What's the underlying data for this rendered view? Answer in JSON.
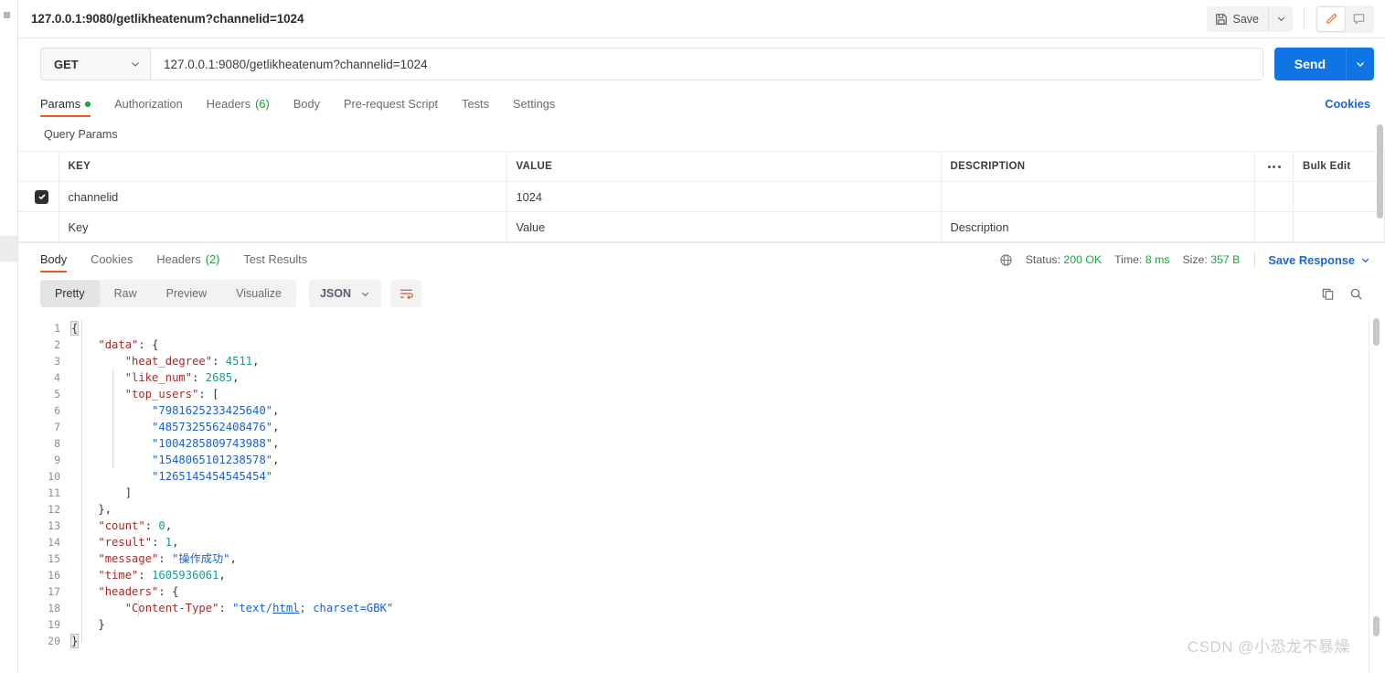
{
  "titlebar": {
    "tab_title": "127.0.0.1:9080/getlikheatenum?channelid=1024",
    "save_label": "Save",
    "save_icon": "floppy-disk-icon",
    "caret_icon": "chevron-down-icon",
    "edit_icon": "pencil-icon",
    "comment_icon": "comment-icon"
  },
  "request": {
    "method": "GET",
    "url": "127.0.0.1:9080/getlikheatenum?channelid=1024",
    "send_label": "Send",
    "tabs": [
      {
        "label": "Params",
        "badge": "",
        "dot": true,
        "active": true
      },
      {
        "label": "Authorization",
        "badge": "",
        "dot": false,
        "active": false
      },
      {
        "label": "Headers",
        "badge": "(6)",
        "dot": false,
        "active": false
      },
      {
        "label": "Body",
        "badge": "",
        "dot": false,
        "active": false
      },
      {
        "label": "Pre-request Script",
        "badge": "",
        "dot": false,
        "active": false
      },
      {
        "label": "Tests",
        "badge": "",
        "dot": false,
        "active": false
      },
      {
        "label": "Settings",
        "badge": "",
        "dot": false,
        "active": false
      }
    ],
    "cookies_link": "Cookies"
  },
  "params": {
    "section_label": "Query Params",
    "columns": [
      "KEY",
      "VALUE",
      "DESCRIPTION"
    ],
    "bulk_edit_label": "Bulk Edit",
    "rows": [
      {
        "checked": true,
        "key": "channelid",
        "value": "1024",
        "description": ""
      }
    ],
    "placeholder_row": {
      "key": "Key",
      "value": "Value",
      "description": "Description"
    }
  },
  "response": {
    "tabs": [
      {
        "label": "Body",
        "badge": "",
        "active": true
      },
      {
        "label": "Cookies",
        "badge": "",
        "active": false
      },
      {
        "label": "Headers",
        "badge": "(2)",
        "active": false
      },
      {
        "label": "Test Results",
        "badge": "",
        "active": false
      }
    ],
    "status_label": "Status:",
    "status_value": "200 OK",
    "time_label": "Time:",
    "time_value": "8 ms",
    "size_label": "Size:",
    "size_value": "357 B",
    "save_response_label": "Save Response",
    "globe_icon": "globe-icon",
    "view_modes": [
      "Pretty",
      "Raw",
      "Preview",
      "Visualize"
    ],
    "active_view_mode": "Pretty",
    "format": "JSON",
    "wrap_icon": "wrap-lines-icon",
    "copy_icon": "copy-icon",
    "search_icon": "search-icon"
  },
  "body_lines": [
    {
      "no": "1",
      "tokens": [
        {
          "t": "{",
          "c": "caret"
        }
      ]
    },
    {
      "no": "2",
      "tokens": [
        {
          "t": "    ",
          "c": "p"
        },
        {
          "t": "\"data\"",
          "c": "k"
        },
        {
          "t": ": {",
          "c": "p"
        }
      ]
    },
    {
      "no": "3",
      "tokens": [
        {
          "t": "        ",
          "c": "p"
        },
        {
          "t": "\"heat_degree\"",
          "c": "k"
        },
        {
          "t": ": ",
          "c": "p"
        },
        {
          "t": "4511",
          "c": "n"
        },
        {
          "t": ",",
          "c": "p"
        }
      ]
    },
    {
      "no": "4",
      "tokens": [
        {
          "t": "        ",
          "c": "p"
        },
        {
          "t": "\"like_num\"",
          "c": "k"
        },
        {
          "t": ": ",
          "c": "p"
        },
        {
          "t": "2685",
          "c": "n"
        },
        {
          "t": ",",
          "c": "p"
        }
      ]
    },
    {
      "no": "5",
      "tokens": [
        {
          "t": "        ",
          "c": "p"
        },
        {
          "t": "\"top_users\"",
          "c": "k"
        },
        {
          "t": ": [",
          "c": "p"
        }
      ]
    },
    {
      "no": "6",
      "tokens": [
        {
          "t": "            ",
          "c": "p"
        },
        {
          "t": "\"7981625233425640\"",
          "c": "s"
        },
        {
          "t": ",",
          "c": "p"
        }
      ]
    },
    {
      "no": "7",
      "tokens": [
        {
          "t": "            ",
          "c": "p"
        },
        {
          "t": "\"4857325562408476\"",
          "c": "s"
        },
        {
          "t": ",",
          "c": "p"
        }
      ]
    },
    {
      "no": "8",
      "tokens": [
        {
          "t": "            ",
          "c": "p"
        },
        {
          "t": "\"1004285809743988\"",
          "c": "s"
        },
        {
          "t": ",",
          "c": "p"
        }
      ]
    },
    {
      "no": "9",
      "tokens": [
        {
          "t": "            ",
          "c": "p"
        },
        {
          "t": "\"1548065101238578\"",
          "c": "s"
        },
        {
          "t": ",",
          "c": "p"
        }
      ]
    },
    {
      "no": "10",
      "tokens": [
        {
          "t": "            ",
          "c": "p"
        },
        {
          "t": "\"1265145454545454\"",
          "c": "s"
        }
      ]
    },
    {
      "no": "11",
      "tokens": [
        {
          "t": "        ]",
          "c": "p"
        }
      ]
    },
    {
      "no": "12",
      "tokens": [
        {
          "t": "    },",
          "c": "p"
        }
      ]
    },
    {
      "no": "13",
      "tokens": [
        {
          "t": "    ",
          "c": "p"
        },
        {
          "t": "\"count\"",
          "c": "k"
        },
        {
          "t": ": ",
          "c": "p"
        },
        {
          "t": "0",
          "c": "n"
        },
        {
          "t": ",",
          "c": "p"
        }
      ]
    },
    {
      "no": "14",
      "tokens": [
        {
          "t": "    ",
          "c": "p"
        },
        {
          "t": "\"result\"",
          "c": "k"
        },
        {
          "t": ": ",
          "c": "p"
        },
        {
          "t": "1",
          "c": "n"
        },
        {
          "t": ",",
          "c": "p"
        }
      ]
    },
    {
      "no": "15",
      "tokens": [
        {
          "t": "    ",
          "c": "p"
        },
        {
          "t": "\"message\"",
          "c": "k"
        },
        {
          "t": ": ",
          "c": "p"
        },
        {
          "t": "\"操作成功\"",
          "c": "s"
        },
        {
          "t": ",",
          "c": "p"
        }
      ]
    },
    {
      "no": "16",
      "tokens": [
        {
          "t": "    ",
          "c": "p"
        },
        {
          "t": "\"time\"",
          "c": "k"
        },
        {
          "t": ": ",
          "c": "p"
        },
        {
          "t": "1605936061",
          "c": "n"
        },
        {
          "t": ",",
          "c": "p"
        }
      ]
    },
    {
      "no": "17",
      "tokens": [
        {
          "t": "    ",
          "c": "p"
        },
        {
          "t": "\"headers\"",
          "c": "k"
        },
        {
          "t": ": {",
          "c": "p"
        }
      ]
    },
    {
      "no": "18",
      "tokens": [
        {
          "t": "        ",
          "c": "p"
        },
        {
          "t": "\"Content-Type\"",
          "c": "k"
        },
        {
          "t": ": ",
          "c": "p"
        },
        {
          "t": "\"text/",
          "c": "s"
        },
        {
          "t": "html",
          "c": "su"
        },
        {
          "t": "; charset=GBK\"",
          "c": "s"
        }
      ]
    },
    {
      "no": "19",
      "tokens": [
        {
          "t": "    }",
          "c": "p"
        }
      ]
    },
    {
      "no": "20",
      "tokens": [
        {
          "t": "}",
          "c": "caret"
        }
      ]
    }
  ],
  "watermark": "CSDN @小恐龙不暴燥",
  "colors": {
    "accent_orange": "#ef5b25",
    "link_blue": "#1a66d6",
    "send_blue": "#1075e4",
    "status_green": "#1aa33c",
    "json_key": "#a52a2a",
    "json_string": "#1a5fd0",
    "json_number": "#1a9c8c"
  }
}
